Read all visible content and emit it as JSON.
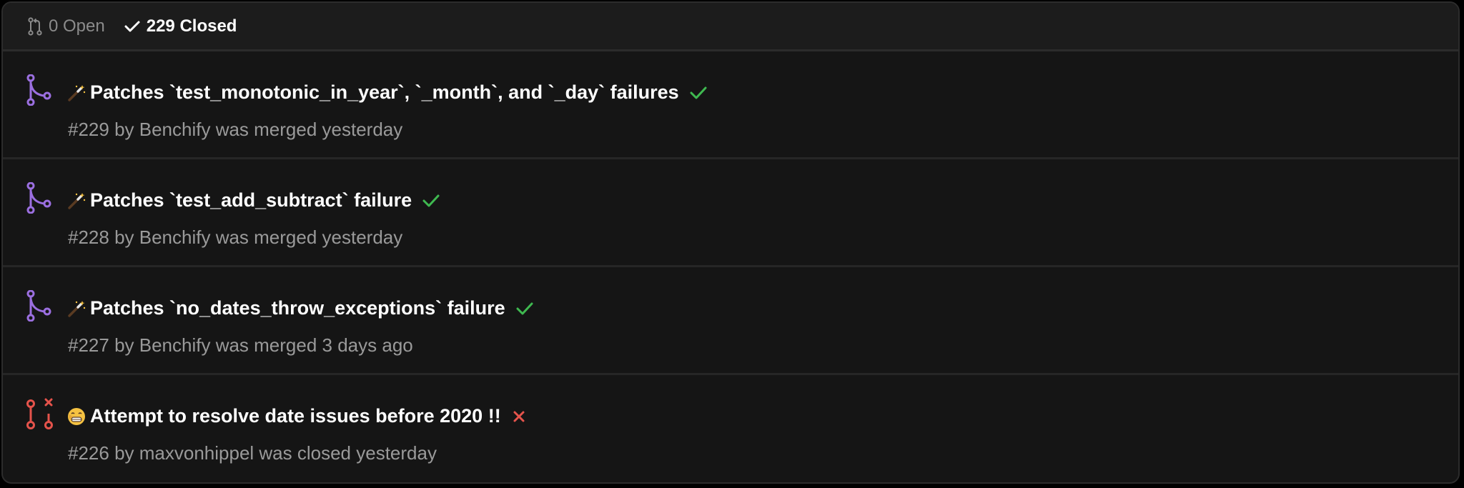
{
  "filters": {
    "open_label": "0 Open",
    "closed_label": "229 Closed"
  },
  "colors": {
    "merged": "#9b6fe0",
    "closed": "#e5534b",
    "check": "#3fb950"
  },
  "pull_requests": [
    {
      "title": "Patches `test_monotonic_in_year`, `_month`, and `_day` failures",
      "meta": "#229 by Benchify was merged yesterday",
      "state": "merged",
      "emoji": "magic-wand-icon",
      "status": "check"
    },
    {
      "title": "Patches `test_add_subtract` failure",
      "meta": "#228 by Benchify was merged yesterday",
      "state": "merged",
      "emoji": "magic-wand-icon",
      "status": "check"
    },
    {
      "title": "Patches `no_dates_throw_exceptions` failure",
      "meta": "#227 by Benchify was merged 3 days ago",
      "state": "merged",
      "emoji": "magic-wand-icon",
      "status": "check"
    },
    {
      "title": "Attempt to resolve date issues before 2020 !!",
      "meta": "#226 by maxvonhippel was closed yesterday",
      "state": "closed",
      "emoji": "grimace-face-icon",
      "status": "cross"
    }
  ]
}
